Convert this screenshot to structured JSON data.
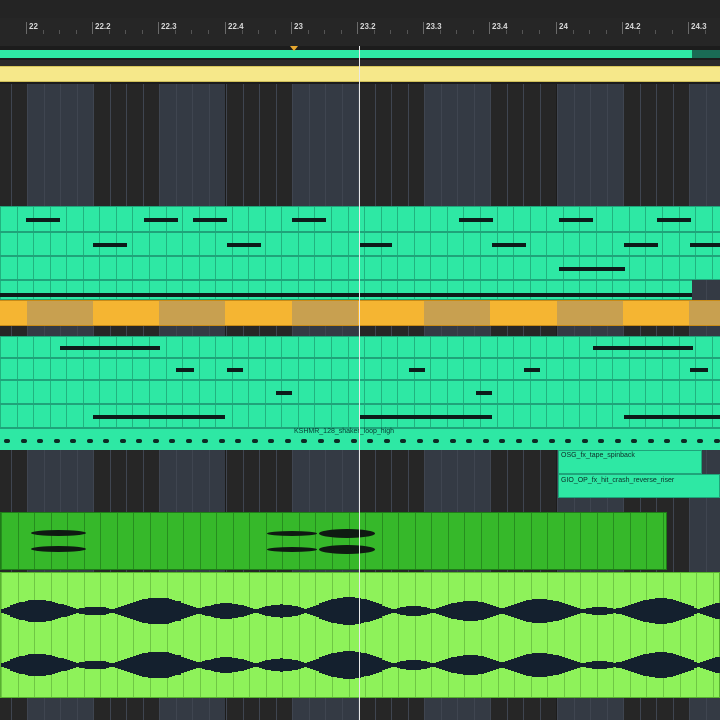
{
  "app": {
    "name": "DAW arrangement view",
    "accent_color": "#2ee8a4",
    "clip_color_midi": "#2ee8a4",
    "clip_color_audio_dark": "#36b82a",
    "clip_color_audio_light": "#8ef25a",
    "clip_color_yellow": "#f6e88a",
    "clip_color_orange": "#f5b532"
  },
  "ruler": {
    "bar_labels": [
      "22",
      "22.2",
      "22.3",
      "22.4",
      "23",
      "23.2",
      "23.3",
      "23.4",
      "24",
      "24.2",
      "24.3"
    ]
  },
  "clips": {
    "shaker_loop": "KSHMR_128_shaker_loop_high",
    "tape_spinback": "OSG_fx_tape_spinback",
    "crash_riser": "GIO_OP_fx_hit_crash_reverse_riser"
  },
  "transport": {
    "playhead_icon": "playhead-line",
    "locator_icon": "loop-marker-triangle-icon"
  }
}
